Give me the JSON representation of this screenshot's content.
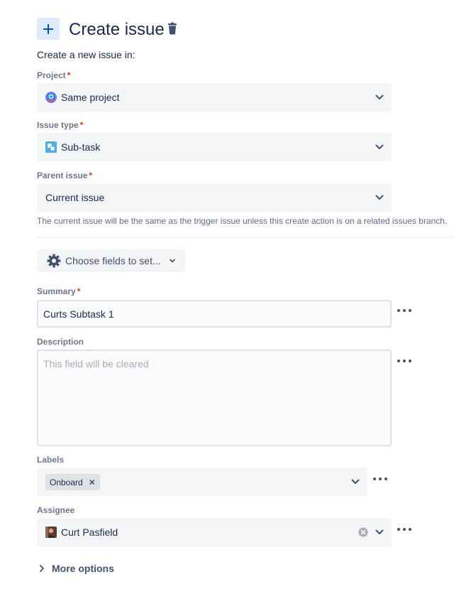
{
  "header": {
    "title": "Create issue",
    "icons": {
      "add": "plus-icon",
      "delete": "trash-icon"
    }
  },
  "intro": "Create a new issue in:",
  "fields": {
    "project": {
      "label": "Project",
      "required_mark": "*",
      "value": "Same project",
      "icon": "project-avatar-icon"
    },
    "issue_type": {
      "label": "Issue type",
      "required_mark": "*",
      "value": "Sub-task",
      "icon": "subtask-icon"
    },
    "parent_issue": {
      "label": "Parent issue",
      "required_mark": "*",
      "value": "Current issue",
      "hint": "The current issue will be the same as the trigger issue unless this create action is on a related issues branch."
    },
    "choose_fields": {
      "label": "Choose fields to set...",
      "icon": "gear-icon"
    },
    "summary": {
      "label": "Summary",
      "required_mark": "*",
      "value": "Curts Subtask 1"
    },
    "description": {
      "label": "Description",
      "placeholder": "This field will be cleared"
    },
    "labels": {
      "label": "Labels",
      "tags": [
        "Onboard"
      ]
    },
    "assignee": {
      "label": "Assignee",
      "value": "Curt Pasfield",
      "icon": "user-avatar-icon"
    }
  },
  "more_options": "More options",
  "colors": {
    "accent_tile": "#DEEBFF",
    "text": "#172B4D",
    "muted": "#6B778C",
    "required": "#DE350B",
    "field_bg": "#F4F5F7"
  }
}
